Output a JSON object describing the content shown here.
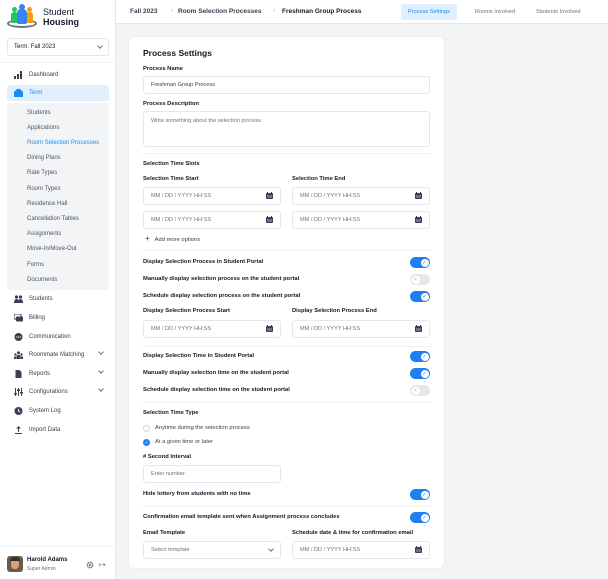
{
  "app": {
    "logo_line1": "Student",
    "logo_line2": "Housing"
  },
  "sidebar": {
    "term_select": {
      "label": "Term:",
      "value": "Fall 2023"
    },
    "items": [
      {
        "label": "Dashboard",
        "icon": "bar-chart-icon"
      },
      {
        "label": "Term",
        "icon": "folder-icon",
        "active": true
      },
      {
        "label": "Students",
        "icon": "users-icon"
      },
      {
        "label": "Billing",
        "icon": "billing-icon"
      },
      {
        "label": "Communication",
        "icon": "chat-icon"
      },
      {
        "label": "Roommate Matching",
        "icon": "roommate-icon",
        "expandable": true
      },
      {
        "label": "Reports",
        "icon": "report-icon",
        "expandable": true
      },
      {
        "label": "Configurations",
        "icon": "sliders-icon",
        "expandable": true
      },
      {
        "label": "System Log",
        "icon": "clock-icon"
      },
      {
        "label": "Import Data",
        "icon": "upload-icon"
      }
    ],
    "term_subitems": [
      {
        "label": "Students"
      },
      {
        "label": "Applications"
      },
      {
        "label": "Room Selection Processes",
        "active": true
      },
      {
        "label": "Dining Plans"
      },
      {
        "label": "Rate Types"
      },
      {
        "label": "Room Types"
      },
      {
        "label": "Residence Hall"
      },
      {
        "label": "Cancellation Tables"
      },
      {
        "label": "Assignments"
      },
      {
        "label": "Move-In/Move-Out"
      },
      {
        "label": "Forms"
      },
      {
        "label": "Documents"
      }
    ],
    "profile": {
      "name": "Harold Adams",
      "role": "Super Admin"
    }
  },
  "topbar": {
    "breadcrumb": [
      "Fall 2023",
      "Room Selection Processes",
      "Freshman Group Process"
    ],
    "tabs": [
      {
        "label": "Process Settings",
        "active": true
      },
      {
        "label": "Rooms Involved"
      },
      {
        "label": "Students Involved"
      }
    ]
  },
  "form": {
    "title": "Process Settings",
    "process_name": {
      "label": "Process Name",
      "value": "Freshman Group Process"
    },
    "process_description": {
      "label": "Process Description",
      "placeholder": "Write something about the selection process"
    },
    "time_slots": {
      "heading": "Selection Time Slots",
      "start_label": "Selection Time Start",
      "end_label": "Selection Time End",
      "date_placeholder": "MM / DD / YYYY HH:SS",
      "add_more": "Add more options"
    },
    "toggles": [
      {
        "label": "Display Selection Process in Student Portal",
        "on": true
      },
      {
        "label": "Manually display selection process on the student portal",
        "on": false
      },
      {
        "label": "Schedule display selection process on the student portal",
        "on": true
      },
      {
        "label": "Display Selection Time in Student Portal",
        "on": true
      },
      {
        "label": "Manually display selection time on the student portal",
        "on": true
      },
      {
        "label": "Schedule display selection time on the student portal",
        "on": false
      },
      {
        "label": "Hide lottery from students with no time",
        "on": true
      },
      {
        "label": "Confirmation email template sent when Assignment process concludes",
        "on": true
      }
    ],
    "display_process": {
      "start_label": "Display Selection Process Start",
      "end_label": "Display Selection Process End"
    },
    "selection_time_type": {
      "heading": "Selection Time Type",
      "options": [
        {
          "label": "Anytime during the selection process",
          "checked": false
        },
        {
          "label": "At a given time or later",
          "checked": true
        }
      ]
    },
    "second_interval": {
      "label": "# Second Interval",
      "placeholder": "Enter number"
    },
    "email_template": {
      "label": "Email Template",
      "placeholder": "Select template"
    },
    "confirmation_schedule": {
      "label": "Schedule date & time for confirmation email"
    }
  }
}
